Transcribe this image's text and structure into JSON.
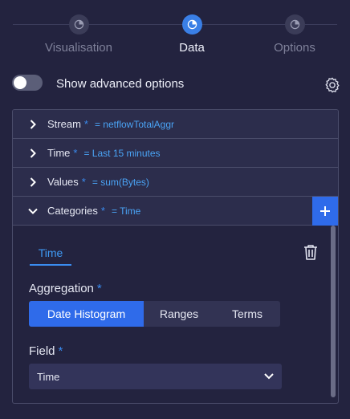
{
  "stepper": {
    "steps": [
      {
        "label": "Visualisation",
        "icon": "chart-icon",
        "active": false
      },
      {
        "label": "Data",
        "icon": "chart-icon",
        "active": true
      },
      {
        "label": "Options",
        "icon": "chart-icon",
        "active": false
      }
    ]
  },
  "advanced": {
    "label": "Show advanced options",
    "enabled": false
  },
  "accordion": {
    "items": [
      {
        "name": "Stream",
        "required": "*",
        "value": "= netflowTotalAggr",
        "expanded": false
      },
      {
        "name": "Time",
        "required": "*",
        "value": "= Last 15 minutes",
        "expanded": false
      },
      {
        "name": "Values",
        "required": "*",
        "value": "= sum(Bytes)",
        "expanded": false
      },
      {
        "name": "Categories",
        "required": "*",
        "value": "= Time",
        "expanded": true
      }
    ]
  },
  "categories": {
    "tab": "Time",
    "aggregation_label": "Aggregation",
    "aggregation_required": "*",
    "aggregation_options": [
      "Date Histogram",
      "Ranges",
      "Terms"
    ],
    "aggregation_selected": "Date Histogram",
    "field_label": "Field",
    "field_required": "*",
    "field_value": "Time"
  },
  "colors": {
    "background": "#23233f",
    "accent": "#2f6bea",
    "link": "#4aa3f5"
  }
}
